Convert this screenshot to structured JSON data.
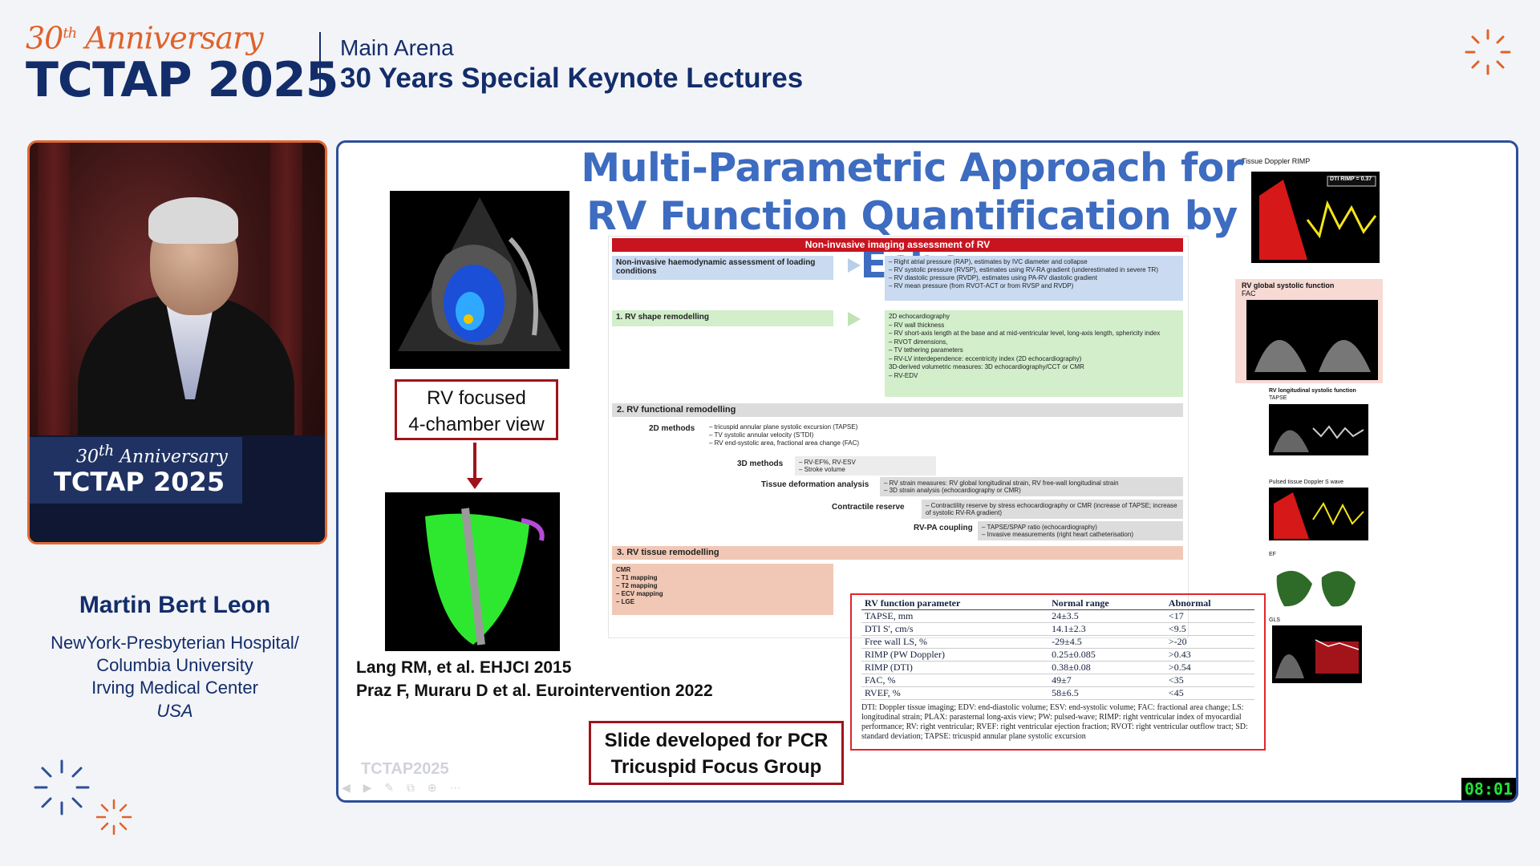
{
  "header": {
    "anniversary": "30th Anniversary",
    "brand": "TCTAP 2025",
    "venue": "Main Arena",
    "session": "30 Years Special Keynote Lectures"
  },
  "video": {
    "podium_anniversary": "30th Anniversary",
    "podium_brand": "TCTAP 2025"
  },
  "speaker": {
    "name": "Martin Bert Leon",
    "affiliation_lines": [
      "NewYork-Presbyterian Hospital/",
      "Columbia University",
      "Irving Medical Center"
    ],
    "country": "USA"
  },
  "slide": {
    "title_line1": "Multi-Parametric Approach for",
    "title_line2": "RV Function Quantification by Echo",
    "rv_label_line1": "RV focused",
    "rv_label_line2": "4-chamber view",
    "ref1": "Lang RM, et al. EHJCI 2015",
    "ref2": "Praz F, Muraru D et al. Eurointervention 2022",
    "pcr_line1": "Slide developed for PCR",
    "pcr_line2": "Tricuspid Focus Group",
    "watermark": "TCTAP2025",
    "imaging_table": {
      "title": "Non-invasive imaging assessment of RV",
      "haemo_label": "Non-invasive haemodynamic assessment of loading conditions",
      "haemo_items": "– Right atrial pressure (RAP), estimates by IVC diameter and collapse\n– RV systolic pressure (RVSP), estimates using RV-RA gradient (underestimated in severe TR)\n– RV diastolic pressure (RVDP), estimates using PA-RV diastolic gradient\n– RV mean pressure (from RVOT-ACT or from RVSP and RVDP)",
      "shape_label": "1. RV shape remodelling",
      "shape_items": "2D echocardiography\n– RV wall thickness\n– RV short-axis length at the base and at mid-ventricular level, long-axis length, sphericity index\n– RVOT dimensions,\n– TV tethering parameters\n– RV-LV interdependence: eccentricity index (2D echocardiography)\n3D-derived volumetric measures: 3D echocardiography/CCT or CMR\n– RV-EDV",
      "functional_label": "2. RV functional remodelling",
      "methods_2d_label": "2D methods",
      "methods_2d_items": "– tricuspid annular plane systolic excursion (TAPSE)\n– TV systolic annular velocity (S'TDI)\n– RV end-systolic area, fractional area change (FAC)",
      "methods_3d_label": "3D methods",
      "methods_3d_items": "– RV-EF%, RV-ESV\n– Stroke volume",
      "tissue_label": "Tissue deformation analysis",
      "tissue_items": "– RV strain measures: RV global longitudinal strain, RV free-wall longitudinal strain\n– 3D strain analysis (echocardiography or CMR)",
      "contractile_label": "Contractile reserve",
      "contractile_items": "– Contractility reserve by stress echocardiography or CMR (increase of TAPSE; increase of systolic RV-RA gradient)",
      "coupling_label": "RV-PA coupling",
      "coupling_items": "– TAPSE/SPAP ratio (echocardiography)\n– Invasive measurements (right heart catheterisation)",
      "tissue_remodelling_label": "3. RV tissue remodelling",
      "cmr_items": "CMR\n– T1 mapping\n– T2 mapping\n– ECV mapping\n– LGE"
    },
    "param_table": {
      "headers": [
        "RV function parameter",
        "Normal range",
        "Abnormal"
      ],
      "rows": [
        [
          "TAPSE, mm",
          "24±3.5",
          "<17"
        ],
        [
          "DTI S', cm/s",
          "14.1±2.3",
          "<9.5"
        ],
        [
          "Free wall LS, %",
          "-29±4.5",
          ">-20"
        ],
        [
          "RIMP (PW Doppler)",
          "0.25±0.085",
          ">0.43"
        ],
        [
          "RIMP (DTI)",
          "0.38±0.08",
          ">0.54"
        ],
        [
          "FAC, %",
          "49±7",
          "<35"
        ],
        [
          "RVEF, %",
          "58±6.5",
          "<45"
        ]
      ],
      "footnote": "DTI: Doppler tissue imaging; EDV: end-diastolic volume; ESV: end-systolic volume; FAC: fractional area change; LS: longitudinal strain; PLAX: parasternal long-axis view; PW: pulsed-wave; RIMP: right ventricular index of myocardial performance; RV: right ventricular; RVEF: right ventricular ejection fraction; RVOT: right ventricular outflow tract; SD: standard deviation; TAPSE: tricuspid annular plane systolic excursion"
    },
    "thumbs": {
      "tdi_label": "Tissue Doppler RIMP",
      "tdi_value": "DTI RIMP = 0.37",
      "global_label": "RV global systolic function",
      "global_sub": "FAC",
      "long_label": "RV longitudinal systolic function",
      "long_sub": "TAPSE",
      "pulsed_label": "Pulsed tissue Doppler S wave",
      "ef_label": "EF",
      "gls_label": "GLS"
    },
    "timer": "08:01"
  },
  "colors": {
    "brand_navy": "#132d6b",
    "accent_orange": "#e0622a",
    "slide_title_blue": "#3d6cc0",
    "box_red": "#a0131b"
  }
}
